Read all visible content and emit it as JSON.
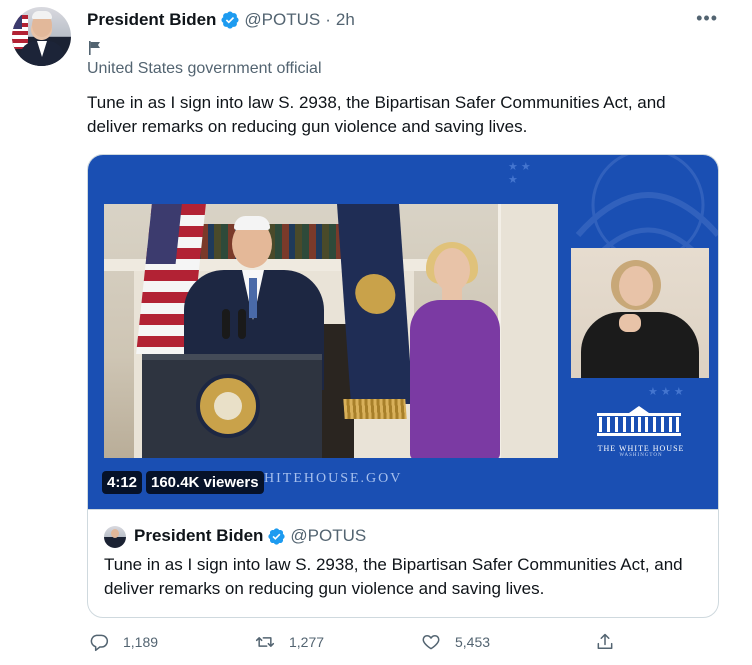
{
  "tweet": {
    "author_name": "President Biden",
    "handle": "@POTUS",
    "separator": "·",
    "time": "2h",
    "label": "United States government official",
    "text": "Tune in as I sign into law S. 2938, the Bipartisan Safer Communities Act, and deliver remarks on reducing gun violence and saving lives.",
    "more_icon": "more-dots-icon"
  },
  "media": {
    "duration": "4:12",
    "viewers": "160.4K viewers",
    "url_text": "HITEHOUSE.GOV",
    "logo_title": "THE WHITE HOUSE",
    "logo_subtitle": "WASHINGTON"
  },
  "quoted": {
    "author_name": "President Biden",
    "handle": "@POTUS",
    "text": "Tune in as I sign into law S. 2938, the Bipartisan Safer Communities Act, and deliver remarks on reducing gun violence and saving lives."
  },
  "actions": {
    "replies": "1,189",
    "retweets": "1,277",
    "likes": "5,453"
  },
  "colors": {
    "verified": "#1d9bf0",
    "media_bg": "#1a4fb3",
    "secondary_text": "#536471"
  }
}
